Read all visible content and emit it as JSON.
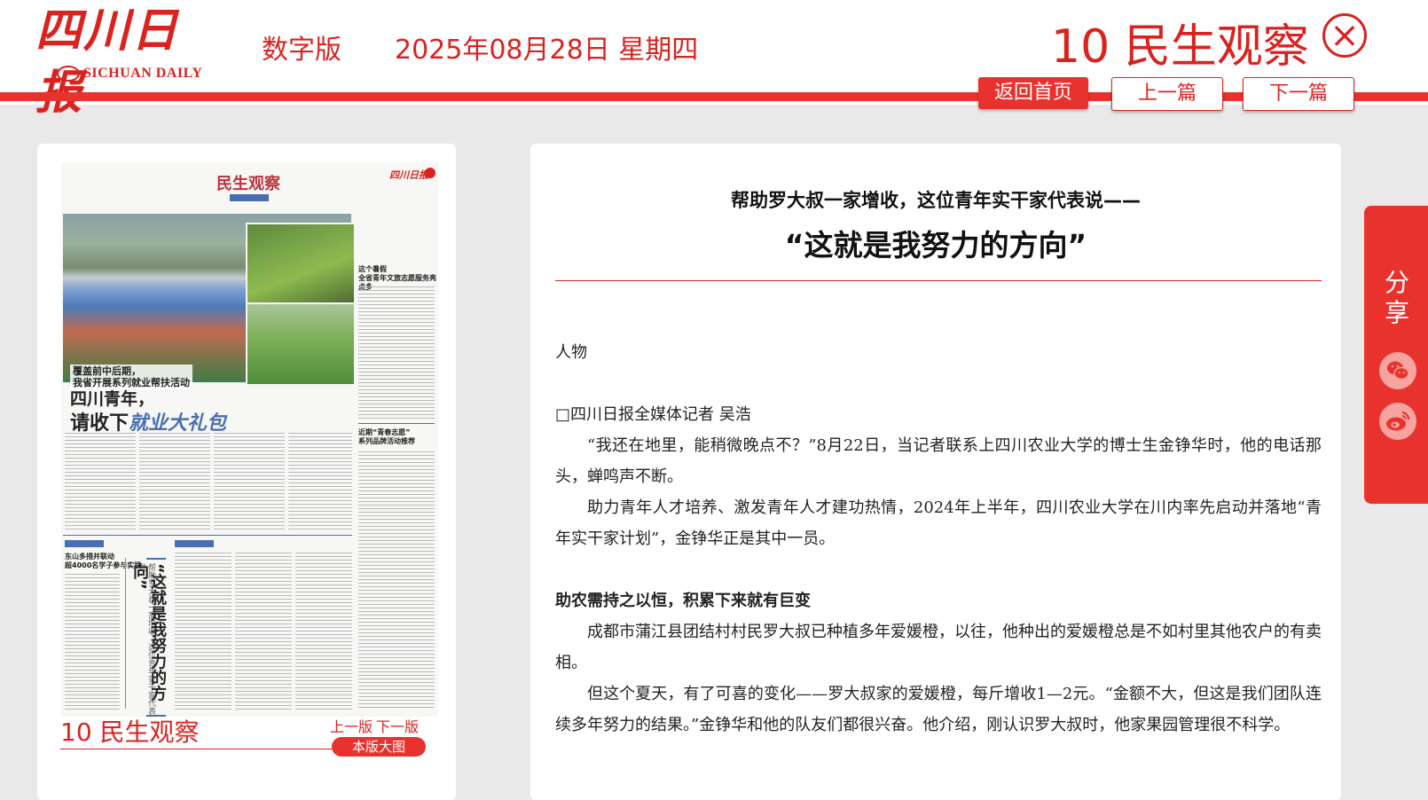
{
  "header": {
    "logo_cn": "四川日报",
    "logo_en": "SICHUAN DAILY",
    "edition": "数字版",
    "date": "2025年08月28日 星期四",
    "page_name": "10 民生观察",
    "buttons": {
      "home": "返回首页",
      "prev_article": "上一篇",
      "next_article": "下一篇"
    }
  },
  "left_panel": {
    "newspaper": {
      "section": "民生观察",
      "kicker": "覆盖前中后期，\n我省开展系列就业帮扶活动",
      "headline_line1": "四川青年，",
      "headline_line2_plain": "请收下",
      "headline_line2_emph": "就业大礼包",
      "side_title1": "这个暑假\n全省青年文旅志愿服务亮点多",
      "side_title2": "近期“青春志愿”\n系列品牌活动推荐",
      "small_head": "东山多措并联动\n超4000名学子参与实践",
      "vertical_title": "“这就是我努力的方向”",
      "vertical_sub": "帮助罗大叔一家增收，这位青年实干家代表说"
    },
    "page_label": "10 民生观察",
    "prev_page": "上一版",
    "next_page": "下一版",
    "big_image": "本版大图"
  },
  "article": {
    "subtitle": "帮助罗大叔一家增收，这位青年实干家代表说——",
    "title": "“这就是我努力的方向”",
    "category": "人物",
    "byline": "□四川日报全媒体记者 吴浩",
    "paragraphs": [
      "“我还在地里，能稍微晚点不？”8月22日，当记者联系上四川农业大学的博士生金铮华时，他的电话那头，蝉鸣声不断。",
      "助力青年人才培养、激发青年人才建功热情，2024年上半年，四川农业大学在川内率先启动并落地“青年实干家计划”，金铮华正是其中一员。"
    ],
    "section_heading": "助农需持之以恒，积累下来就有巨变",
    "paragraphs2": [
      "成都市蒲江县团结村村民罗大叔已种植多年爱媛橙，以往，他种出的爱媛橙总是不如村里其他农户的有卖相。",
      "但这个夏天，有了可喜的变化——罗大叔家的爱媛橙，每斤增收1—2元。“金额不大，但这是我们团队连续多年努力的结果。”金铮华和他的队友们都很兴奋。他介绍，刚认识罗大叔时，他家果园管理很不科学。"
    ]
  },
  "share": {
    "label": "分享",
    "icons": [
      "wechat-icon",
      "weibo-icon"
    ]
  },
  "colors": {
    "brand_red": "#e8322e",
    "dark_red": "#d9231f"
  }
}
